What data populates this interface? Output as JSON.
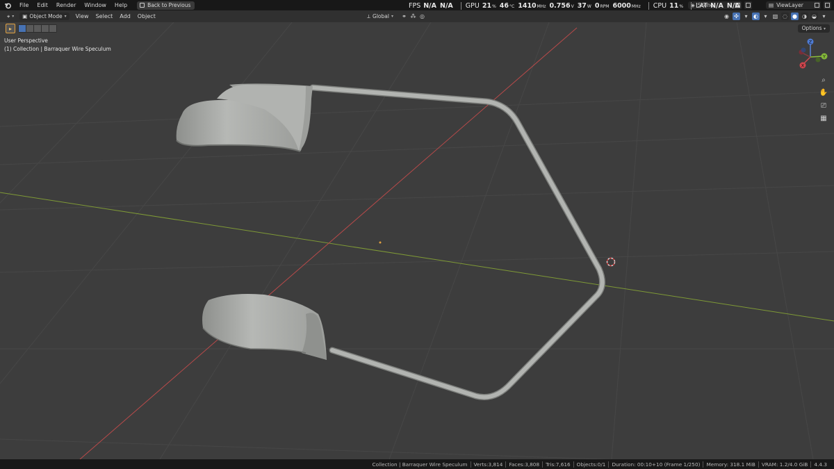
{
  "menu": {
    "items": [
      "File",
      "Edit",
      "Render",
      "Window",
      "Help"
    ],
    "back_button": "Back to Previous"
  },
  "perf": {
    "fps_label": "FPS",
    "fps_value": "N/A",
    "fps_value2": "N/A",
    "gpu_label": "GPU",
    "gpu_usage": "21",
    "gpu_usage_unit": "%",
    "gpu_temp": "46",
    "gpu_temp_unit": "°C",
    "gpu_clock": "1410",
    "gpu_clock_unit": "MHz",
    "gpu_voltage": "0.756",
    "gpu_voltage_unit": "V",
    "gpu_power": "37",
    "gpu_power_unit": "W",
    "gpu_fan": "0",
    "gpu_fan_unit": "RPM",
    "gpu_mem_clock": "6000",
    "gpu_mem_clock_unit": "MHz",
    "cpu_label": "CPU",
    "cpu_usage": "11",
    "cpu_usage_unit": "%",
    "lat_label": "LAT",
    "lat_value": "N/A",
    "lat_value2": "N/A"
  },
  "scene": {
    "name": "Scene"
  },
  "view_layer": {
    "name": "ViewLayer"
  },
  "header": {
    "mode": "Object Mode",
    "menus": [
      "View",
      "Select",
      "Add",
      "Object"
    ],
    "orientation": "Global",
    "options": "Options"
  },
  "viewport": {
    "perspective": "User Perspective",
    "collection_info": "(1) Collection | Barraquer Wire Speculum"
  },
  "gizmo": {
    "z": "Z",
    "y": "Y",
    "x": "X"
  },
  "statusbar": [
    "Collection | Barraquer Wire Speculum",
    "Verts:3,814",
    "Faces:3,808",
    "Tris:7,616",
    "Objects:0/1",
    "Duration: 00:10+10 (Frame 1/250)",
    "Memory: 318.1 MiB",
    "VRAM: 1.2/4.0 GiB",
    "4.4.3"
  ],
  "colors": {
    "background": "#3d3d3d",
    "active_blue": "#4772b3",
    "x_axis": "#c04b4b",
    "y_axis": "#8aa03a",
    "object_gray": "#a8aaa7"
  }
}
